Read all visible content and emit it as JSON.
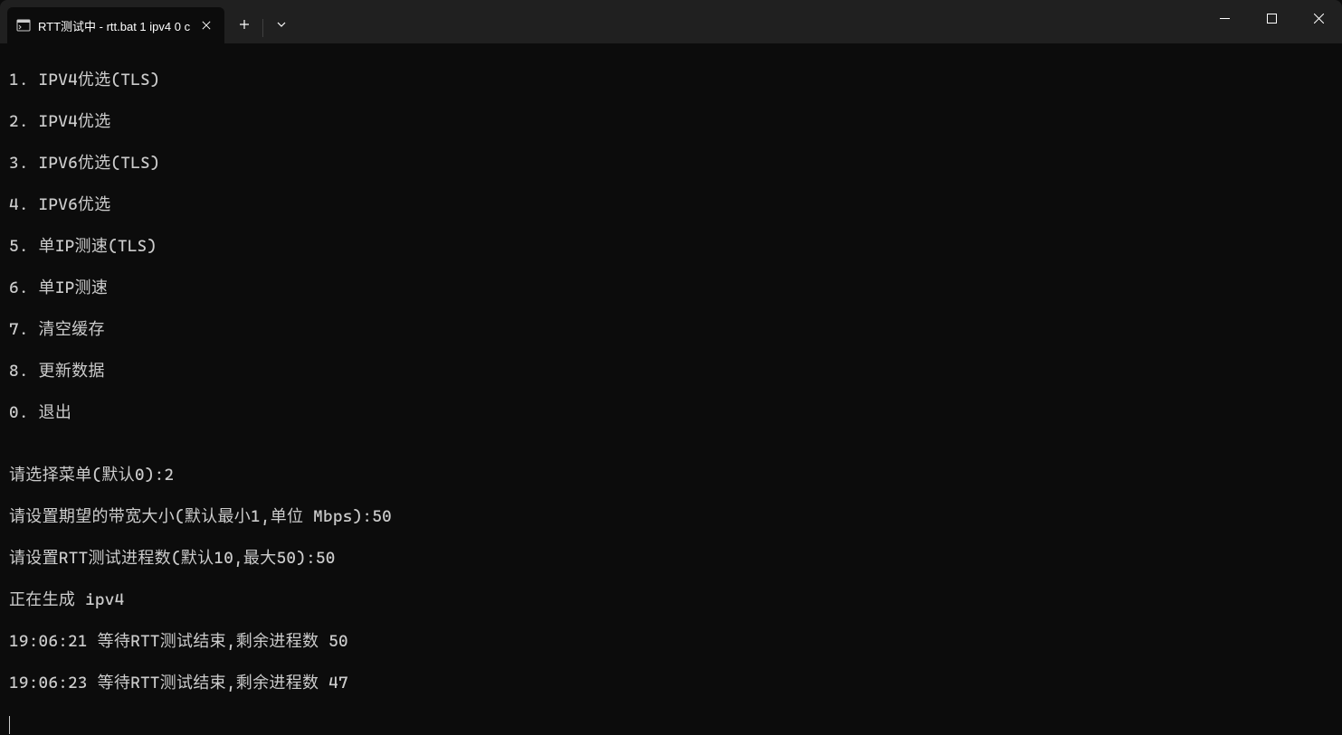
{
  "window": {
    "tab_title": "RTT测试中 - rtt.bat   1 ipv4 0 c"
  },
  "menu": {
    "items": [
      "1. IPV4优选(TLS)",
      "2. IPV4优选",
      "3. IPV6优选(TLS)",
      "4. IPV6优选",
      "5. 单IP测速(TLS)",
      "6. 单IP测速",
      "7. 清空缓存",
      "8. 更新数据",
      "0. 退出"
    ]
  },
  "prompts": {
    "blank": "",
    "select_menu": "请选择菜单(默认0):2",
    "bandwidth": "请设置期望的带宽大小(默认最小1,单位 Mbps):50",
    "rtt_threads": "请设置RTT测试进程数(默认10,最大50):50",
    "generating": "正在生成 ipv4",
    "log1": "19:06:21 等待RTT测试结束,剩余进程数 50",
    "log2": "19:06:23 等待RTT测试结束,剩余进程数 47"
  }
}
